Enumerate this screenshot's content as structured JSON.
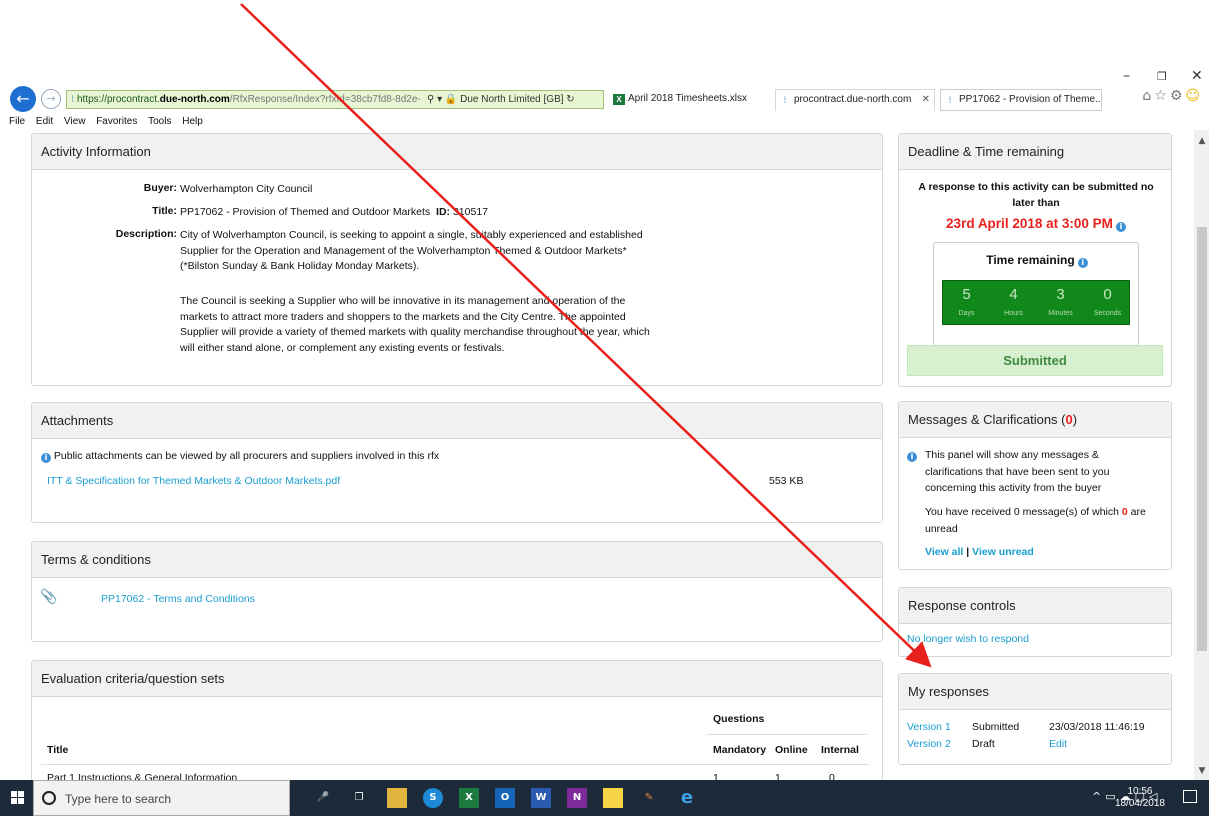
{
  "browser": {
    "url_prefix": "https://procontract.",
    "url_domain": "due-north.com",
    "url_path": "/RfxResponse/Index?rfxId=38cb7fd8-8d2e-",
    "site_identity": "Due North Limited [GB]",
    "tabs": [
      {
        "label": "April 2018 Timesheets.xlsx",
        "icon": "excel-icon"
      },
      {
        "label": "procontract.due-north.com",
        "icon": "loading-icon",
        "active": true
      },
      {
        "label": "PP17062 - Provision of Theme...",
        "icon": "loading-icon"
      }
    ],
    "menu": [
      "File",
      "Edit",
      "View",
      "Favorites",
      "Tools",
      "Help"
    ]
  },
  "activity": {
    "heading": "Activity Information",
    "buyer_label": "Buyer:",
    "buyer": "Wolverhampton City Council",
    "title_label": "Title:",
    "title": "PP17062 - Provision of Themed and Outdoor Markets",
    "id_label": "ID:",
    "id": "310517",
    "description_label": "Description:",
    "description_p1": "City of Wolverhampton Council, is seeking to appoint a single, suitably experienced and established Supplier for the Operation and Management of the Wolverhampton Themed & Outdoor Markets* (*Bilston Sunday & Bank Holiday Monday Markets).",
    "description_p2": "The Council is seeking a Supplier who will be innovative in its management and operation of the markets to attract more traders and shoppers to the markets and the City Centre. The appointed Supplier will provide a variety of themed markets with quality merchandise throughout the year, which will either stand alone, or complement any existing events or festivals."
  },
  "attachments": {
    "heading": "Attachments",
    "note": "Public attachments can be viewed by all procurers and suppliers involved in this rfx",
    "file_name": "ITT & Specification for Themed Markets & Outdoor Markets.pdf",
    "file_size": "553 KB"
  },
  "terms": {
    "heading": "Terms & conditions",
    "link": "PP17062 - Terms and Conditions"
  },
  "evaluation": {
    "heading": "Evaluation criteria/question sets",
    "questions_header": "Questions",
    "columns": [
      "Title",
      "Mandatory",
      "Online",
      "Internal"
    ],
    "rows": [
      {
        "title": "Part 1 Instructions & General Information",
        "mandatory": "1",
        "online": "1",
        "internal": "0"
      }
    ]
  },
  "deadline": {
    "heading": "Deadline & Time remaining",
    "intro": "A response to this activity can be submitted no later than",
    "date": "23rd April 2018 at 3:00 PM",
    "time_remaining_label": "Time remaining",
    "countdown": [
      {
        "value": "5",
        "unit": "Days"
      },
      {
        "value": "4",
        "unit": "Hours"
      },
      {
        "value": "3",
        "unit": "Minutes"
      },
      {
        "value": "0",
        "unit": "Seconds"
      }
    ],
    "status": "Submitted"
  },
  "messages": {
    "heading": "Messages & Clarifications (",
    "count": "0",
    "heading_close": ")",
    "info": "This panel will show any messages & clarifications that have been sent to you concerning this activity from the buyer",
    "received_pre": "You have received 0 message(s) of which",
    "unread_count": "0",
    "received_post": "are unread",
    "view_all": "View all",
    "separator": "|",
    "view_unread": "View unread"
  },
  "response_controls": {
    "heading": "Response controls",
    "link": "No longer wish to respond"
  },
  "my_responses": {
    "heading": "My responses",
    "rows": [
      {
        "version": "Version 1",
        "status": "Submitted",
        "detail": "23/03/2018 11:46:19"
      },
      {
        "version": "Version 2",
        "status": "Draft",
        "detail": "Edit"
      }
    ]
  },
  "taskbar": {
    "search_placeholder": "Type here to search",
    "time": "10:56",
    "date": "18/04/2018"
  },
  "colors": {
    "link": "#1a9ed0",
    "deadline_red": "#e8211c",
    "countdown_green": "#10881a",
    "arrow_red": "#e8211c"
  }
}
